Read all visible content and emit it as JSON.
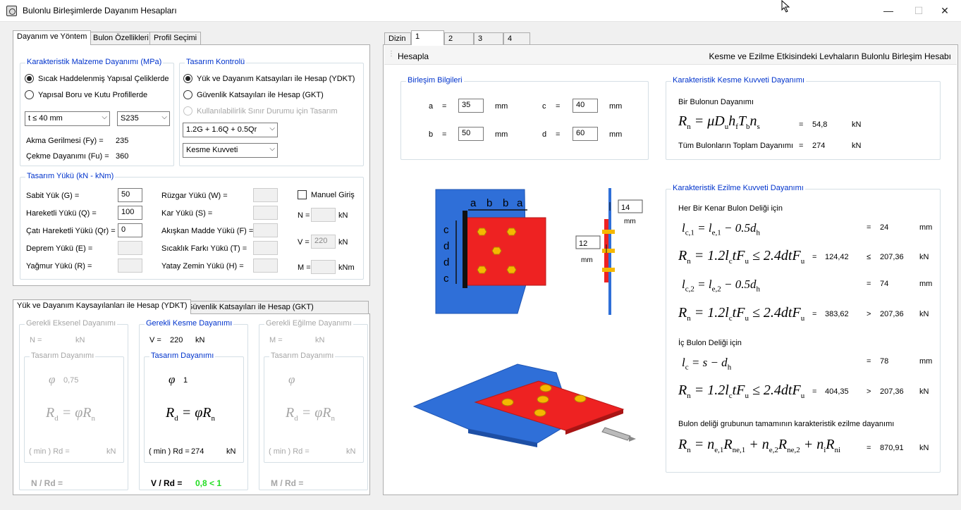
{
  "window": {
    "title": "Bulonlu Birleşimlerde Dayanım Hesapları",
    "minimize": "—",
    "maximize": "☐",
    "close": "✕"
  },
  "left_tabs": [
    "Dayanım ve Yöntem",
    "Bulon Özellikleri",
    "Profil Seçimi"
  ],
  "material": {
    "group_label": "Karakteristik Malzeme Dayanımı (MPa)",
    "radio1": "Sıcak Haddelenmiş Yapısal Çeliklerde",
    "radio2": "Yapısal Boru ve Kutu Profillerde",
    "thickness": "t ≤ 40 mm",
    "steel": "S235",
    "fy_label": "Akma Gerilmesi (Fy) =",
    "fy": "235",
    "fu_label": "Çekme Dayanımı (Fu) =",
    "fu": "360"
  },
  "design": {
    "group_label": "Tasarım Kontrolü",
    "radio1": "Yük ve Dayanım Katsayıları ile Hesap (YDKT)",
    "radio2": "Güvenlik Katsayıları ile Hesap (GKT)",
    "radio3": "Kullanılabilirlik Sınır Durumu için Tasarım",
    "combination": "1.2G + 1.6Q + 0.5Qr",
    "force": "Kesme Kuvveti"
  },
  "loads": {
    "group_label": "Tasarım Yükü (kN - kNm)",
    "g_label": "Sabit Yük (G) =",
    "g": "50",
    "q_label": "Hareketli Yükü (Q) =",
    "q": "100",
    "qr_label": "Çatı Hareketli Yükü (Qr) =",
    "qr": "0",
    "e_label": "Deprem Yükü (E) =",
    "r_label": "Yağmur Yükü (R) =",
    "w_label": "Rüzgar Yükü (W) =",
    "s_label": "Kar Yükü (S) =",
    "f_label": "Akışkan Madde Yükü (F) =",
    "t_label": "Sıcaklık Farkı Yükü (T) =",
    "h_label": "Yatay Zemin Yükü (H) =",
    "manual_label": "Manuel Giriş",
    "n_label": "N =",
    "n_unit": "kN",
    "v_label": "V =",
    "v": "220",
    "v_unit": "kN",
    "m_label": "M =",
    "m_unit": "kNm"
  },
  "bottom_tabs": [
    "Yük ve Dayanım Kaysayılanları ile Hesap (YDKT)",
    "Güvenlik Katsayıları ile Hesap (GKT)"
  ],
  "axial": {
    "label": "Gerekli Eksenel Dayanımı",
    "n_label": "N =",
    "unit": "kN",
    "design_label": "Tasarım Dayanımı",
    "phi": "φ",
    "phi_value": "0,75",
    "rd_label": "( min ) Rd =",
    "rd_unit": "kN",
    "ratio_label": "N / Rd ="
  },
  "shear": {
    "label": "Gerekli Kesme Dayanımı",
    "v_label": "V =",
    "v": "220",
    "unit": "kN",
    "design_label": "Tasarım Dayanımı",
    "phi": "φ",
    "phi_value": "1",
    "rd_label": "( min ) Rd =",
    "rd": "274",
    "rd_unit": "kN",
    "ratio_label": "V / Rd =",
    "ratio": "0,8 < 1",
    "ratio_color": "#22dd22"
  },
  "moment": {
    "label": "Gerekli Eğilme Dayanımı",
    "m_label": "M =",
    "unit": "kN",
    "design_label": "Tasarım Dayanımı",
    "phi": "φ",
    "rd_label": "( min ) Rd =",
    "rd_unit": "kN",
    "ratio_label": "M / Rd ="
  },
  "formula_rd": {
    "r": "R",
    "d": "d",
    "eq": " = ",
    "phi": "φ",
    "n": "n"
  },
  "right_tabs": [
    "Dizin",
    "1",
    "2",
    "3",
    "4"
  ],
  "header": {
    "hesapla": "Hesapla",
    "title": "Kesme ve Ezilme Etkisindeki Levhaların Bulonlu Birleşim Hesabı"
  },
  "connection": {
    "label": "Birleşim Bilgileri",
    "a_label": "a",
    "a": "35",
    "b_label": "b",
    "b": "50",
    "c_label": "c",
    "c": "40",
    "d_label": "d",
    "d": "60",
    "eq": "=",
    "unit": "mm"
  },
  "shear_strength": {
    "label": "Karakteristik Kesme Kuvveti Dayanımı",
    "single_label": "Bir Bulonun Dayanımı",
    "single_value": "54,8",
    "unit": "kN",
    "eq": "=",
    "total_label": "Tüm Bulonların Toplam Dayanımı",
    "total_value": "274"
  },
  "bearing": {
    "label": "Karakteristik Ezilme Kuvveti Dayanımı",
    "edge_label": "Her Bir Kenar Bulon Deliği için",
    "lc1": "24",
    "r1": "124,42",
    "cmp1": "≤",
    "lim1": "207,36",
    "lc2": "74",
    "r2": "383,62",
    "cmp2": ">",
    "lim2": "207,36",
    "inner_label": "İç Bulon Deliği için",
    "lc": "78",
    "r3": "404,35",
    "cmp3": ">",
    "lim3": "207,36",
    "group_label": "Bulon deliği grubunun tamamının karakteristik ezilme dayanımı",
    "total": "870,91",
    "mm": "mm",
    "kn": "kN",
    "eq": "="
  },
  "drawing": {
    "a": "a",
    "b": "b",
    "c": "c",
    "d": "d",
    "dim1": "14",
    "dim2": "12",
    "unit": "mm"
  },
  "colors": {
    "accent": "#0033cc",
    "plate_red": "#ee2222",
    "gusset_blue": "#2f6fd8",
    "ok_green": "#22dd22"
  }
}
